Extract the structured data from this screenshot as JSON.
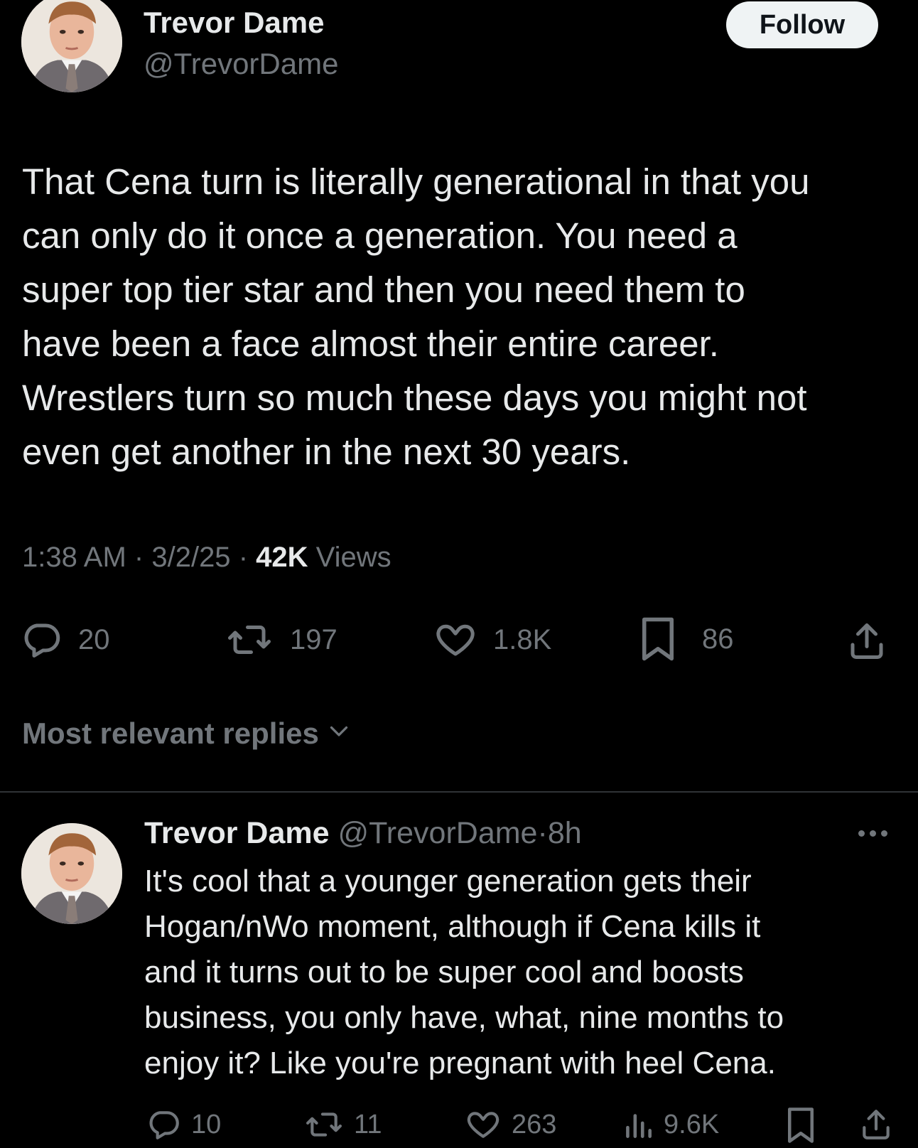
{
  "tweet": {
    "author_name": "Trevor Dame",
    "author_handle": "@TrevorDame",
    "follow_label": "Follow",
    "text": "That Cena turn is literally generational in that you\ncan only do it once a generation. You need a\nsuper top tier star and then you need them to\nhave been a face almost their entire career.\nWrestlers turn so much these days you might not\neven get another in the next 30 years.",
    "time": "1:38 AM",
    "date": "3/2/25",
    "views_count": "42K",
    "views_label": "Views",
    "separator": "·",
    "replies": "20",
    "reposts": "197",
    "likes": "1.8K",
    "bookmarks": "86"
  },
  "replies_sort": {
    "label": "Most relevant replies"
  },
  "reply": {
    "author_name": "Trevor Dame",
    "author_handle": "@TrevorDame",
    "separator": "·",
    "age": "8h",
    "text": "It's cool that a younger generation gets their\nHogan/nWo moment, although if Cena kills it\nand it turns out to be super cool and boosts\nbusiness, you only have, what, nine months to\nenjoy it? Like you're pregnant with heel Cena.",
    "replies": "10",
    "reposts": "11",
    "likes": "263",
    "views": "9.6K"
  },
  "colors": {
    "background": "#000000",
    "text": "#e7e9ea",
    "muted": "#71767b",
    "divider": "#2f3336",
    "follow_bg": "#eff3f4"
  },
  "icons": [
    "reply-icon",
    "repost-icon",
    "like-icon",
    "bookmark-icon",
    "share-icon",
    "views-icon",
    "chevron-down-icon",
    "more-icon"
  ]
}
